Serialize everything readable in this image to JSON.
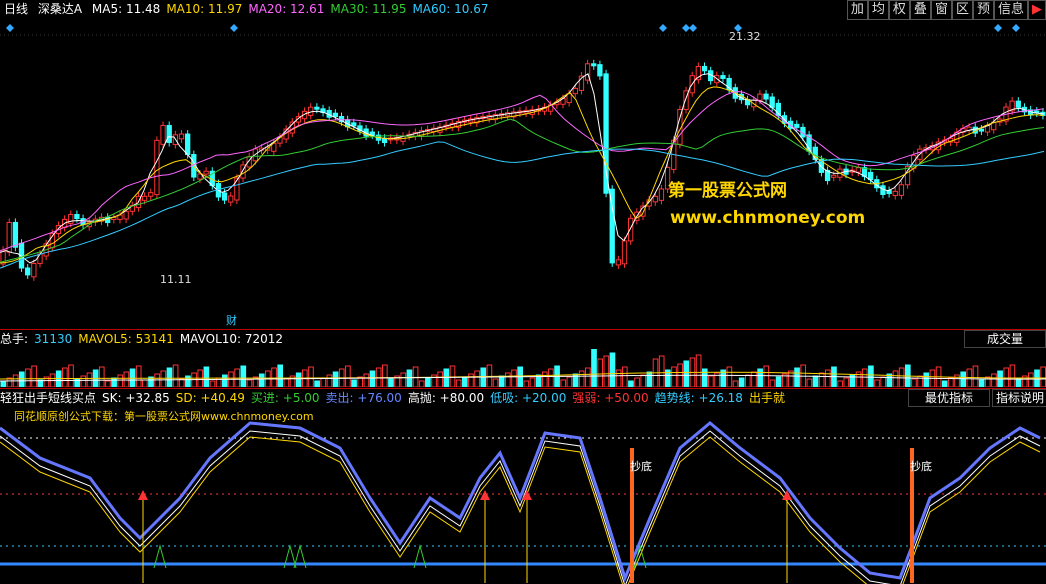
{
  "top": {
    "period": "日线",
    "stock": "深桑达A",
    "ma": [
      {
        "label": "MA5: 11.48",
        "color": "#ffffff"
      },
      {
        "label": "MA10: 11.97",
        "color": "#ffd700"
      },
      {
        "label": "MA20: 12.61",
        "color": "#ff66ff"
      },
      {
        "label": "MA30: 11.95",
        "color": "#33cc33"
      },
      {
        "label": "MA60: 10.67",
        "color": "#33ccff"
      }
    ],
    "buttons": [
      "加",
      "均",
      "权",
      "叠",
      "窗",
      "区",
      "预",
      "信息"
    ]
  },
  "price": {
    "high_label": "21.32",
    "low_label": "11.11",
    "fin_mark": "财"
  },
  "watermark": {
    "cn": "第一股票公式网",
    "url": "www.chnmoney.com"
  },
  "volume": {
    "items": [
      {
        "label": "总手:",
        "color": "#ffffff"
      },
      {
        "label": "31130",
        "color": "#33ccff"
      },
      {
        "label": "MAVOL5: 53141",
        "color": "#ffd700"
      },
      {
        "label": "MAVOL10: 72012",
        "color": "#ffffff"
      }
    ],
    "button": "成交量"
  },
  "indicator": {
    "items": [
      {
        "label": "轻狂出手短线买点",
        "color": "#ffffff"
      },
      {
        "label": "SK: +32.85",
        "color": "#ffffff"
      },
      {
        "label": "SD: +40.49",
        "color": "#ffd700"
      },
      {
        "label": "买进: +5.00",
        "color": "#33cc33"
      },
      {
        "label": "卖出: +76.00",
        "color": "#6688ff"
      },
      {
        "label": "高抛: +80.00",
        "color": "#ffffff"
      },
      {
        "label": "低吸: +20.00",
        "color": "#33ccff"
      },
      {
        "label": "强弱: +50.00",
        "color": "#ff3333"
      },
      {
        "label": "趋势线: +26.18",
        "color": "#33ccff"
      },
      {
        "label": "出手就",
        "color": "#ffd700"
      }
    ],
    "subtitle": "同花顺原创公式下载：第一股票公式网www.chnmoney.com",
    "buttons": [
      "最优指标",
      "指标说明"
    ],
    "bottom_labels": [
      "抄底",
      "抄底"
    ]
  }
}
